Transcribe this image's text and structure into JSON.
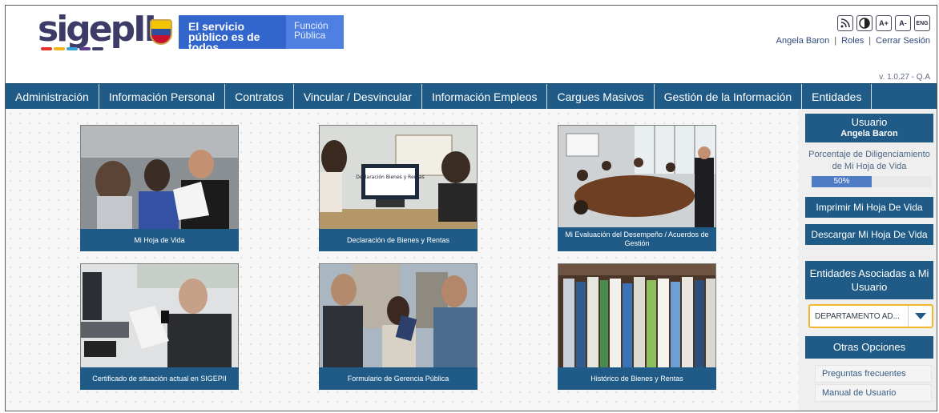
{
  "header": {
    "logo_text": "sigepII",
    "slogan": "El servicio público es de todos",
    "entity": "Función Pública",
    "accessibility": [
      "rss-icon",
      "contrast-icon",
      "A+",
      "A-",
      "ENG"
    ],
    "user_name": "Angela Baron",
    "roles_link": "Roles",
    "logout_link": "Cerrar Sesión",
    "version": "v. 1.0.27 - Q.A"
  },
  "nav": {
    "items": [
      "Administración",
      "Información Personal",
      "Contratos",
      "Vincular / Desvincular",
      "Información Empleos",
      "Cargues Masivos",
      "Gestión de la Información",
      "Entidades"
    ]
  },
  "cards": [
    {
      "label": "Mi Hoja de Vida"
    },
    {
      "label": "Declaración de Bienes y Rentas",
      "screen_text": "Declaración Bienes y Rentas"
    },
    {
      "label": "Mi Evaluación del Desempeño / Acuerdos de Gestión"
    },
    {
      "label": "Certificado de situación actual en SIGEPII"
    },
    {
      "label": "Formulario de Gerencia Pública"
    },
    {
      "label": "Histórico de Bienes y Rentas"
    }
  ],
  "sidebar": {
    "user_title": "Usuario",
    "user_name": "Angela Baron",
    "progress_label": "Porcentaje de Diligenciamiento de Mi Hoja de Vida",
    "progress_value": 50,
    "progress_text": "50%",
    "print_button": "Imprimir Mi Hoja De Vida",
    "download_button": "Descargar Mi Hoja De Vida",
    "entities_title": "Entidades Asociadas a Mi Usuario",
    "entity_selected": "DEPARTAMENTO AD...",
    "other_title": "Otras Opciones",
    "links": [
      "Preguntas frecuentes",
      "Manual de Usuario"
    ]
  },
  "colors": {
    "nav": "#1f5b86",
    "brand_text": "#3d3c68",
    "gov_blue": "#3366cc",
    "progress_fill": "#4e7cc5",
    "select_border": "#f0b72a"
  }
}
